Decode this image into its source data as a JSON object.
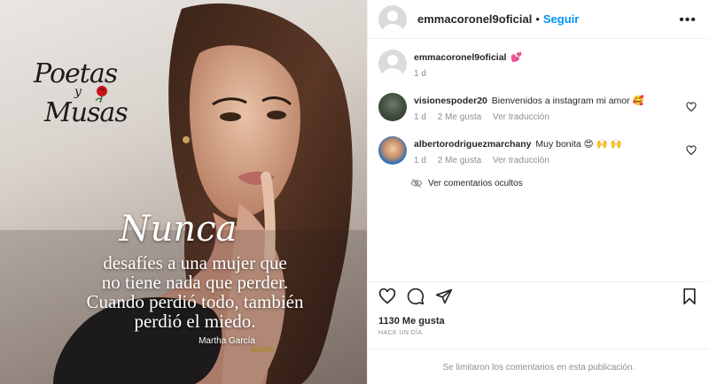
{
  "image": {
    "logo": {
      "line1": "Poetas",
      "line2": "y",
      "line3": "Musas"
    },
    "quote": {
      "first_word": "Nunca",
      "lines": [
        "desafíes a una mujer que",
        "no tiene nada que perder.",
        "Cuando perdió todo, también",
        "perdió el miedo."
      ],
      "author": "Martha García"
    }
  },
  "header": {
    "username": "emmacoronel9oficial",
    "separator": "•",
    "follow_label": "Seguir",
    "more_icon": "more-horizontal-icon"
  },
  "caption": {
    "username": "emmacoronel9oficial",
    "text": "💕",
    "time": "1 d"
  },
  "comments": [
    {
      "username": "visionespoder20",
      "text": "Bienvenidos a instagram mi amor 🥰",
      "time": "1 d",
      "likes": "2 Me gusta",
      "translate": "Ver traducción"
    },
    {
      "username": "albertorodriguezmarchany",
      "text": "Muy bonita 😍 🙌 🙌",
      "time": "1 d",
      "likes": "2 Me gusta",
      "translate": "Ver traducción"
    }
  ],
  "hidden_comments": "Ver comentarios ocultos",
  "actions": {
    "like_icon": "heart-icon",
    "comment_icon": "comment-icon",
    "share_icon": "share-icon",
    "save_icon": "bookmark-icon"
  },
  "likes": "1130 Me gusta",
  "posted": "HACE UN DÍA",
  "comments_limited": "Se limitaron los comentarios en esta publicación.",
  "colors": {
    "follow": "#0095f6",
    "muted": "#8e8e8e",
    "text": "#262626",
    "border": "#efefef"
  }
}
